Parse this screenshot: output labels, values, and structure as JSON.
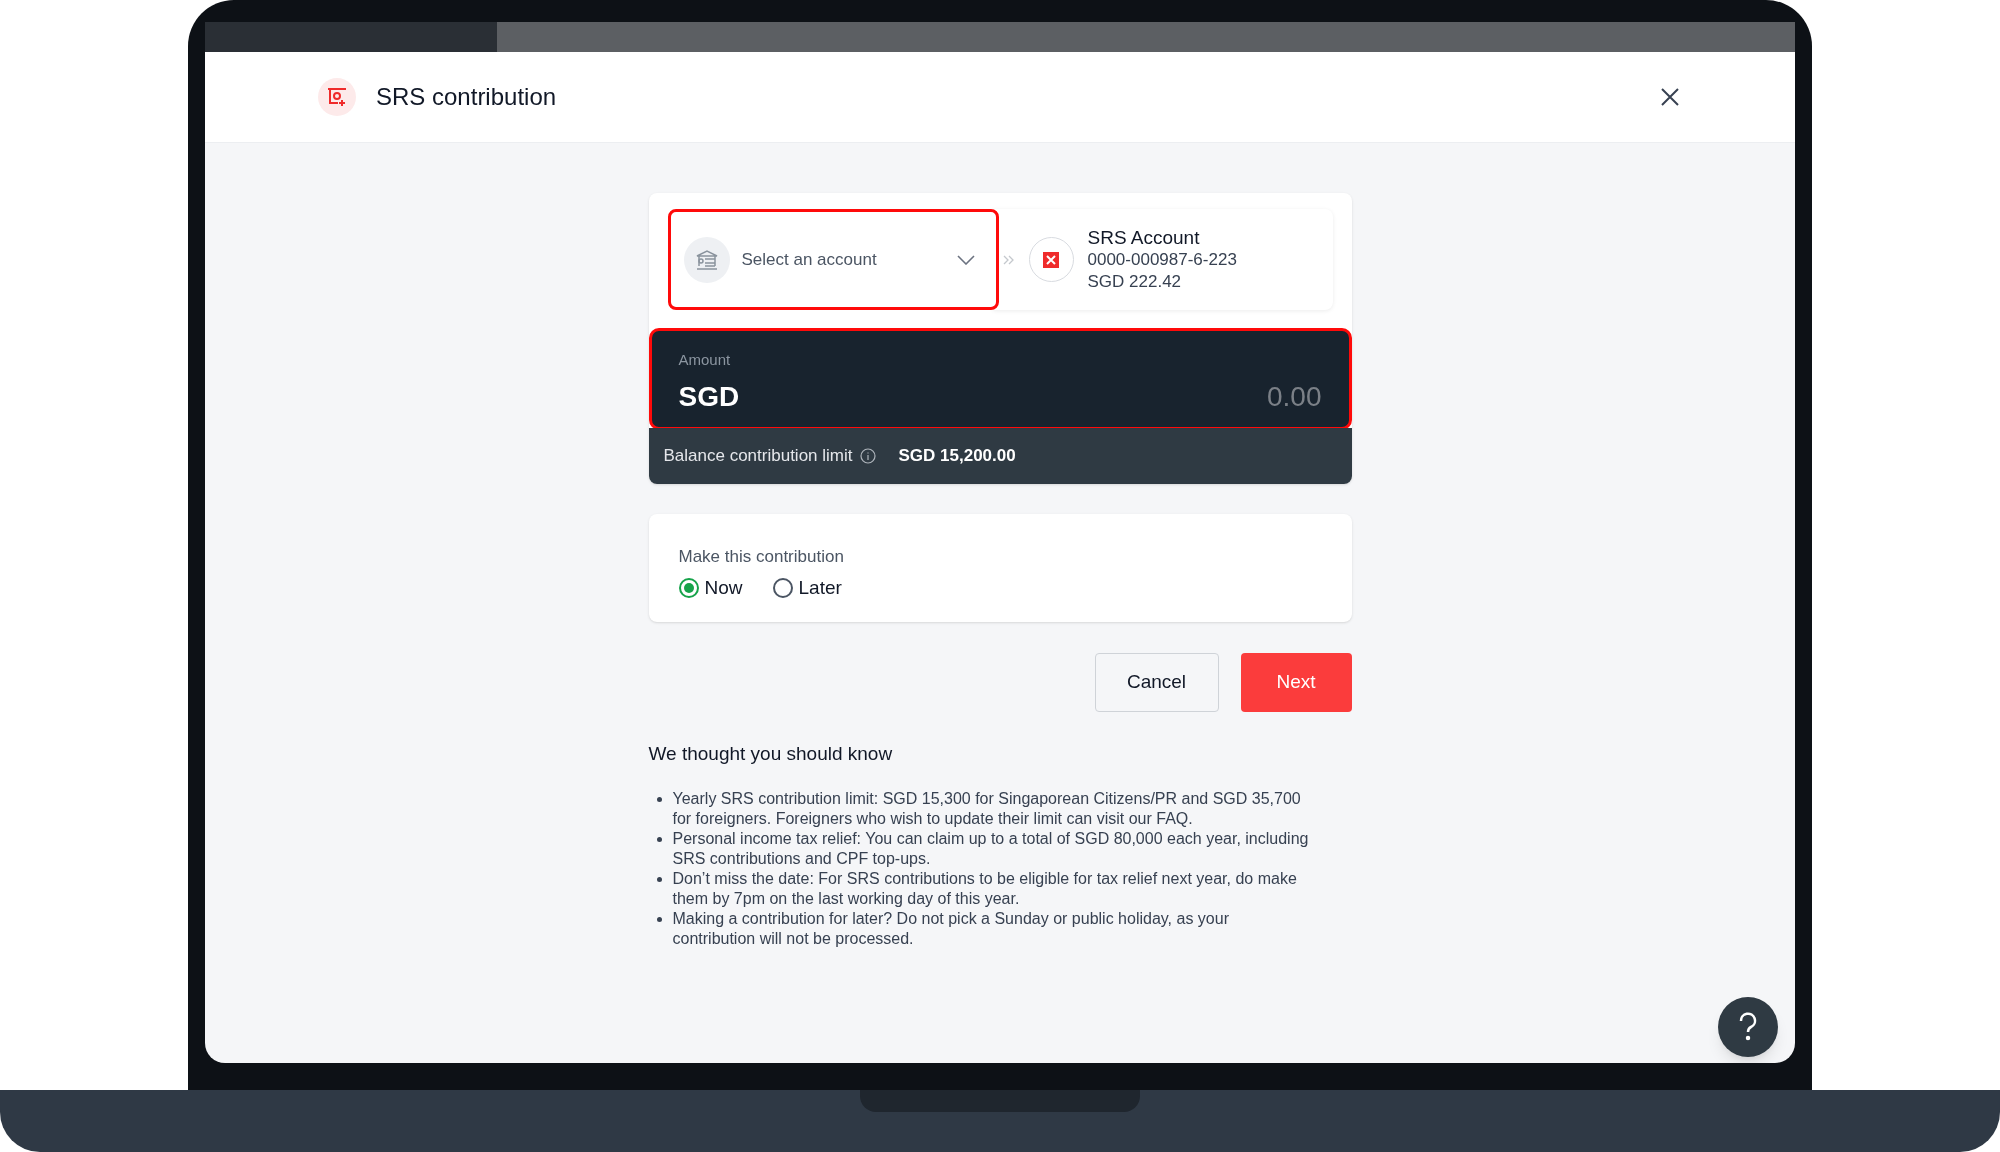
{
  "header": {
    "title": "SRS contribution"
  },
  "from_account": {
    "placeholder": "Select an account"
  },
  "to_account": {
    "name": "SRS Account",
    "number": "0000-000987-6-223",
    "balance": "SGD 222.42"
  },
  "amount": {
    "label": "Amount",
    "currency": "SGD",
    "placeholder": "0.00"
  },
  "limit": {
    "label": "Balance contribution limit",
    "value": "SGD 15,200.00"
  },
  "schedule": {
    "label": "Make this contribution",
    "options": [
      {
        "label": "Now",
        "selected": true
      },
      {
        "label": "Later",
        "selected": false
      }
    ]
  },
  "buttons": [
    {
      "label": "Cancel",
      "kind": "secondary"
    },
    {
      "label": "Next",
      "kind": "primary"
    }
  ],
  "notes": {
    "title": "We thought you should know",
    "items": [
      "Yearly SRS contribution limit: SGD 15,300 for Singaporean Citizens/PR and SGD 35,700 for foreigners. Foreigners who wish to update their limit can visit our FAQ.",
      "Personal income tax relief: You can claim up to a total of SGD 80,000 each year, including SRS contributions and CPF top-ups.",
      "Don’t miss the date: For SRS contributions to be eligible for tax relief next year, do make them by 7pm on the last working day of this year.",
      "Making a contribution for later? Do not pick a Sunday or public holiday, as your contribution will not be processed."
    ]
  }
}
